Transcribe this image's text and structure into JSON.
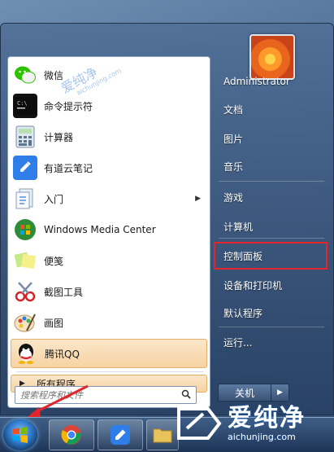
{
  "left_items": [
    {
      "label": "微信",
      "icon": "wechat-icon"
    },
    {
      "label": "命令提示符",
      "icon": "cmd-icon"
    },
    {
      "label": "计算器",
      "icon": "calculator-icon"
    },
    {
      "label": "有道云笔记",
      "icon": "youdao-note-icon"
    },
    {
      "label": "入门",
      "icon": "getting-started-icon",
      "has_submenu": true
    },
    {
      "label": "Windows Media Center",
      "icon": "media-center-icon"
    },
    {
      "label": "便笺",
      "icon": "sticky-notes-icon"
    },
    {
      "label": "截图工具",
      "icon": "snipping-tool-icon"
    },
    {
      "label": "画图",
      "icon": "paint-icon"
    },
    {
      "label": "腾讯QQ",
      "icon": "qq-icon",
      "highlighted": true
    }
  ],
  "all_programs": {
    "label": "所有程序"
  },
  "search": {
    "placeholder": "搜索程序和文件"
  },
  "right_items": [
    {
      "label": "Administrator"
    },
    {
      "label": "文档"
    },
    {
      "label": "图片"
    },
    {
      "label": "音乐"
    },
    {
      "label": "游戏"
    },
    {
      "label": "计算机"
    },
    {
      "label": "控制面板",
      "boxed": true
    },
    {
      "label": "设备和打印机"
    },
    {
      "label": "默认程序"
    },
    {
      "label": "运行..."
    }
  ],
  "shutdown": {
    "label": "关机"
  },
  "taskbar": {
    "apps": [
      "chrome-icon",
      "youdao-note-icon",
      "folder-icon"
    ]
  },
  "colors": {
    "highlight_border": "#e2262b",
    "accent": "#f6d3a3"
  },
  "watermark": {
    "big": "爱纯净",
    "url": "aichunjing.com",
    "small": "爱纯净",
    "small_url": "aichunjing.com"
  }
}
